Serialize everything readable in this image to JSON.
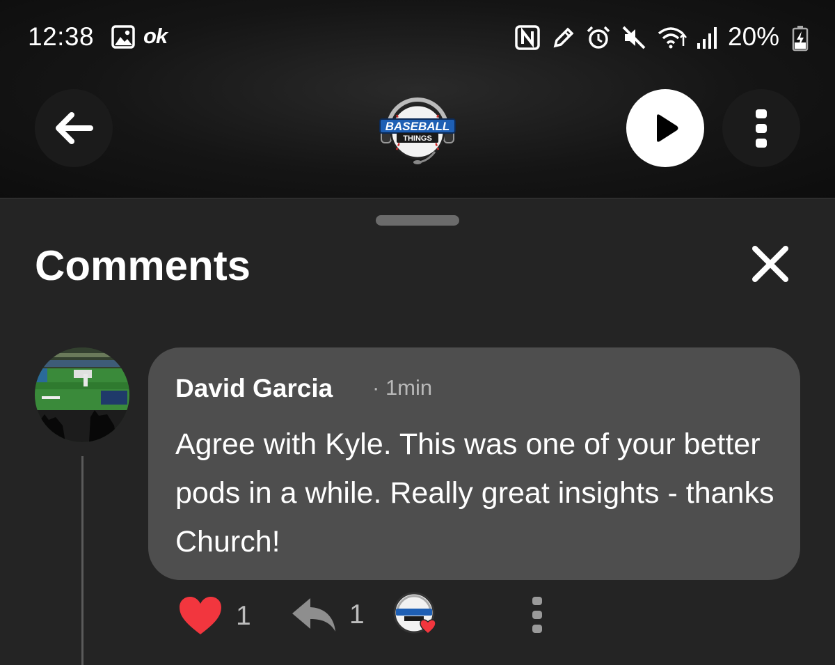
{
  "status_bar": {
    "time": "12:38",
    "badge": "ok",
    "battery": "20%",
    "icons": [
      "gallery-icon",
      "nfc-icon",
      "pen-icon",
      "alarm-icon",
      "mute-icon",
      "wifi-icon",
      "signal-icon",
      "battery-charging-icon"
    ]
  },
  "header": {
    "logo_text_top": "BASEBALL",
    "logo_text_bottom": "THINGS",
    "icons": [
      "back-arrow-icon",
      "play-icon",
      "more-vertical-icon"
    ]
  },
  "sheet": {
    "title": "Comments"
  },
  "comment": {
    "author": "David Garcia",
    "time": "1min",
    "text": "Agree with Kyle.  This was one of your better pods in a while.  Really great insights - thanks Church!",
    "likes": "1",
    "replies": "1"
  },
  "colors": {
    "background": "#242424",
    "bubble": "#4e4e4e",
    "like_red": "#f2363e",
    "logo_blue": "#1e5fb4",
    "logo_red": "#d02a2a"
  }
}
